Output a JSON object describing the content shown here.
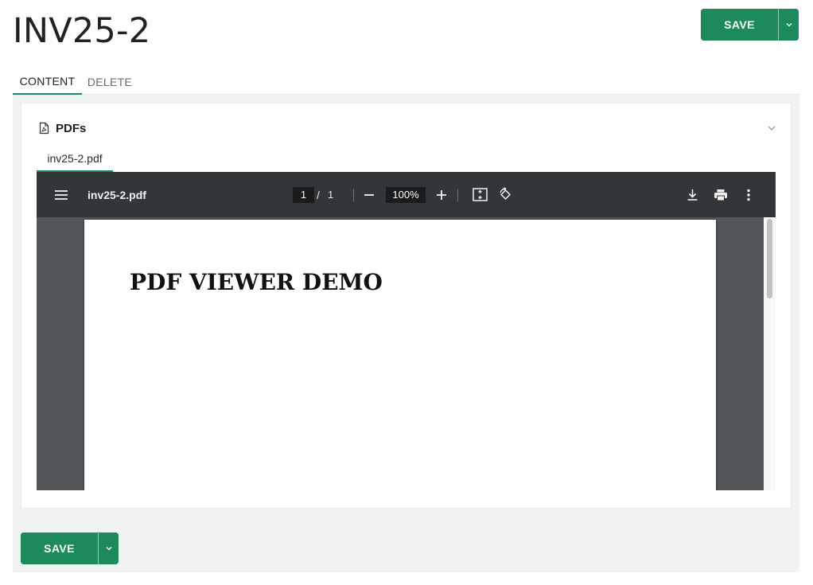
{
  "page": {
    "title": "INV25-2"
  },
  "actions": {
    "save_label": "SAVE"
  },
  "tabs": [
    {
      "label": "CONTENT",
      "active": true
    },
    {
      "label": "DELETE",
      "active": false
    }
  ],
  "card": {
    "title": "PDFs",
    "icon": "pdf-file-icon",
    "file_tab_label": "inv25-2.pdf"
  },
  "viewer": {
    "file_name": "inv25-2.pdf",
    "current_page": "1",
    "page_separator": "/",
    "total_pages": "1",
    "zoom": "100%",
    "document_heading": "PDF VIEWER DEMO"
  },
  "colors": {
    "accent": "#1d8a5c",
    "toolbar": "#323639",
    "viewer_bg": "#525659"
  }
}
